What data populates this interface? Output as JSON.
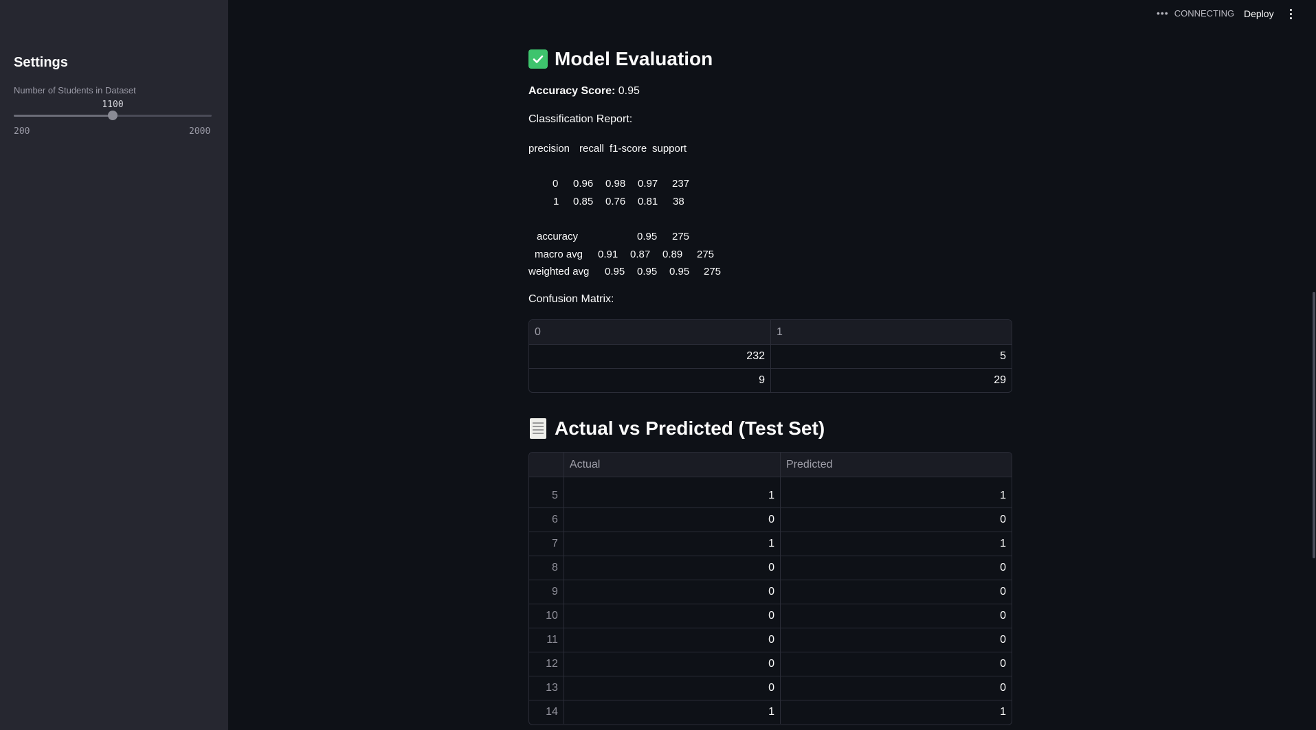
{
  "sidebar": {
    "title": "Settings",
    "slider": {
      "label": "Number of Students in Dataset",
      "value": "1100",
      "min": "200",
      "max": "2000",
      "fraction": 0.5
    }
  },
  "topbar": {
    "status": "CONNECTING",
    "deploy_label": "Deploy"
  },
  "evaluation": {
    "heading": "Model Evaluation",
    "accuracy_label": "Accuracy Score:",
    "accuracy_value": "0.95",
    "report_label": "Classification Report:",
    "report_header": [
      "precision",
      "recall",
      "f1-score",
      "support"
    ],
    "report_rows": [
      {
        "label": "0",
        "values": [
          "0.96",
          "0.98",
          "0.97",
          "237"
        ]
      },
      {
        "label": "1",
        "values": [
          "0.85",
          "0.76",
          "0.81",
          "38"
        ]
      }
    ],
    "accuracy_row": {
      "label": "accuracy",
      "values": [
        "0.95",
        "275"
      ]
    },
    "macro_row": {
      "label": "macro avg",
      "values": [
        "0.91",
        "0.87",
        "0.89",
        "275"
      ]
    },
    "weighted_row": {
      "label": "weighted avg",
      "values": [
        "0.95",
        "0.95",
        "0.95",
        "275"
      ]
    },
    "confusion_label": "Confusion Matrix:",
    "confusion_headers": [
      "0",
      "1"
    ],
    "confusion_rows": [
      [
        "232",
        "5"
      ],
      [
        "9",
        "29"
      ]
    ]
  },
  "predictions": {
    "heading": "Actual vs Predicted (Test Set)",
    "headers": [
      "Actual",
      "Predicted"
    ],
    "rows": [
      {
        "index": "5",
        "actual": "1",
        "predicted": "1"
      },
      {
        "index": "6",
        "actual": "0",
        "predicted": "0"
      },
      {
        "index": "7",
        "actual": "1",
        "predicted": "1"
      },
      {
        "index": "8",
        "actual": "0",
        "predicted": "0"
      },
      {
        "index": "9",
        "actual": "0",
        "predicted": "0"
      },
      {
        "index": "10",
        "actual": "0",
        "predicted": "0"
      },
      {
        "index": "11",
        "actual": "0",
        "predicted": "0"
      },
      {
        "index": "12",
        "actual": "0",
        "predicted": "0"
      },
      {
        "index": "13",
        "actual": "0",
        "predicted": "0"
      },
      {
        "index": "14",
        "actual": "1",
        "predicted": "1"
      }
    ]
  }
}
